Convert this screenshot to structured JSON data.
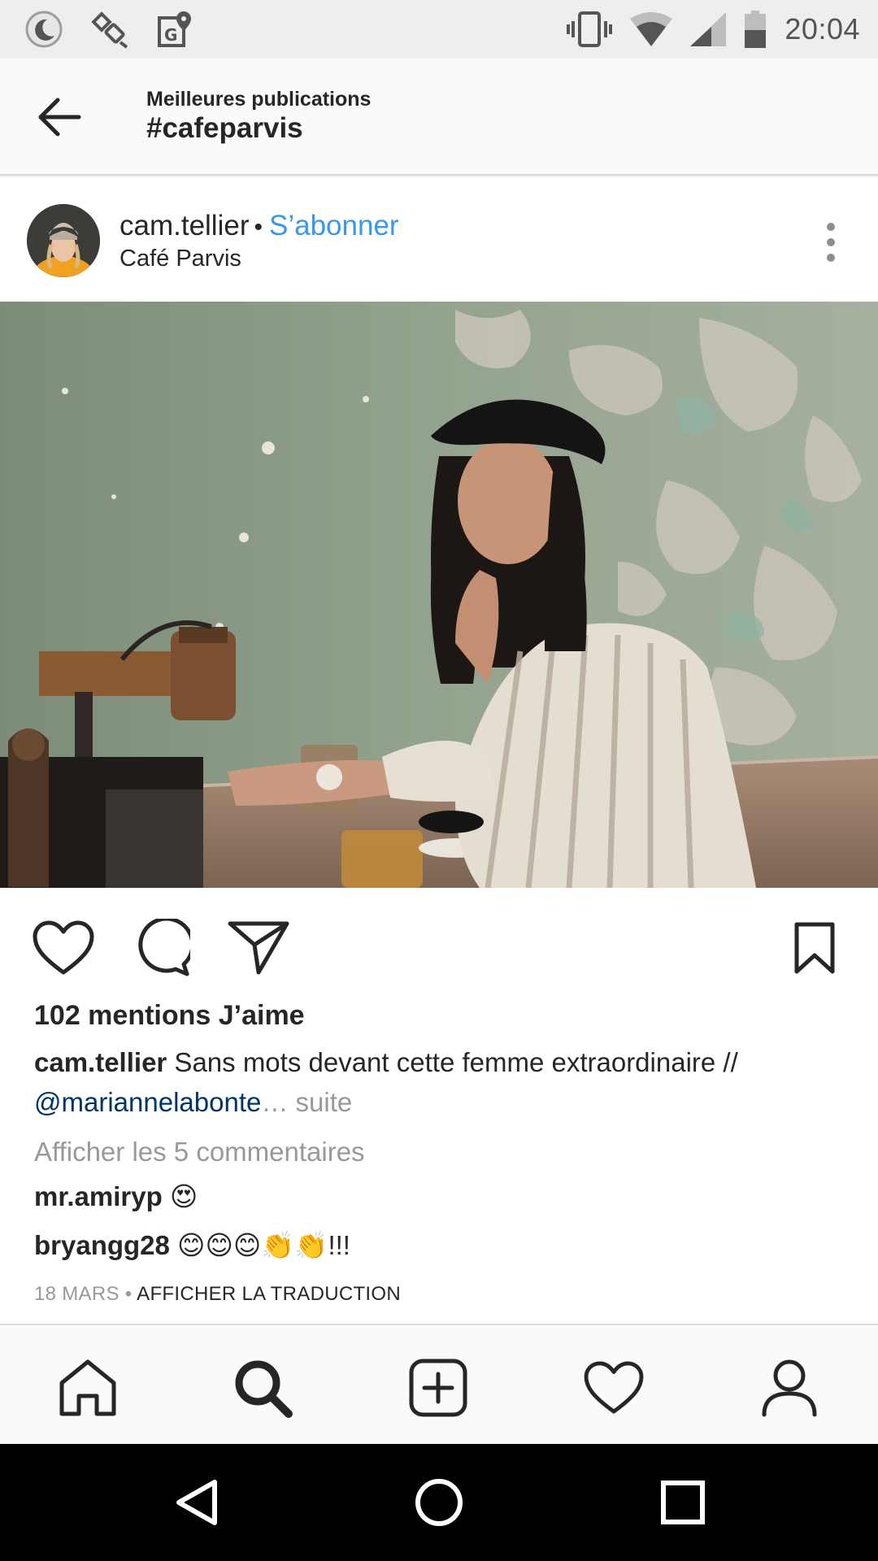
{
  "status_bar": {
    "time": "20:04",
    "left_icons": [
      "moon-icon",
      "satellite-icon",
      "maps-icon"
    ],
    "right_icons": [
      "vibrate-icon",
      "wifi-icon",
      "signal-icon",
      "battery-icon"
    ]
  },
  "header": {
    "subtitle": "Meilleures publications",
    "title": "#cafeparvis",
    "back_icon": "arrow-left-icon"
  },
  "post": {
    "username": "cam.tellier",
    "separator": "•",
    "follow_label": "S’abonner",
    "location": "Café Parvis",
    "likes_text": "102 mentions J’aime",
    "caption_user": "cam.tellier",
    "caption_text": " Sans mots devant cette femme extraordinaire // ",
    "caption_mention": "@mariannelabonte",
    "caption_more": "… suite",
    "view_comments": "Afficher les 5 commentaires",
    "comments": [
      {
        "user": "mr.amiryp",
        "text": " 😍"
      },
      {
        "user": "bryangg28",
        "text": " 😊😊😊👏👏!!!"
      }
    ],
    "date": "18 MARS",
    "date_sep": " • ",
    "translate": "AFFICHER LA TRADUCTION"
  },
  "actions": [
    "heart-icon",
    "comment-icon",
    "share-icon",
    "bookmark-icon"
  ],
  "bottom_nav": [
    "home-icon",
    "search-icon",
    "add-icon",
    "activity-icon",
    "profile-icon"
  ],
  "system_nav": [
    "back-triangle-icon",
    "home-circle-icon",
    "recents-square-icon"
  ],
  "colors": {
    "accent_blue": "#3897f0",
    "mention_blue": "#003569",
    "muted": "#999999",
    "text": "#262626"
  }
}
